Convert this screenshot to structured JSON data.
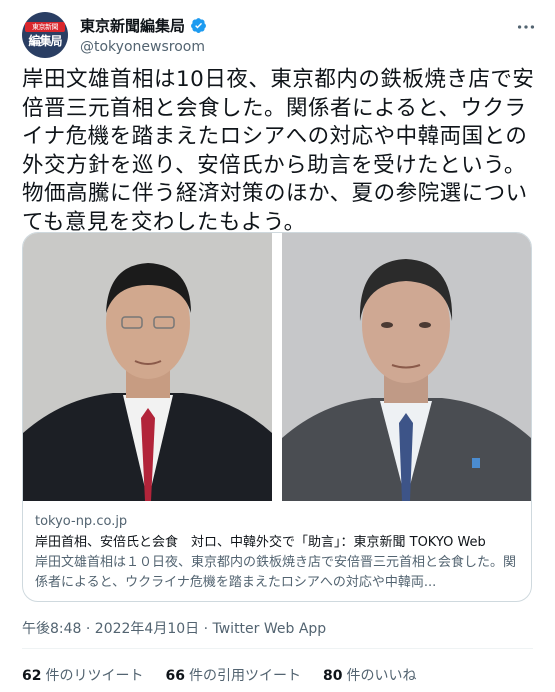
{
  "account": {
    "display_name": "東京新聞編集局",
    "handle": "@tokyonewsroom",
    "avatar_text_top": "東京新聞",
    "avatar_text_bottom": "編集局"
  },
  "tweet": {
    "text": "岸田文雄首相は10日夜、東京都内の鉄板焼き店で安倍晋三元首相と会食した。関係者によると、ウクライナ危機を踏まえたロシアへの対応や中韓両国との外交方針を巡り、安倍氏から助言を受けたという。物価高騰に伴う経済対策のほか、夏の参院選についても意見を交わしたもよう。"
  },
  "card": {
    "domain": "tokyo-np.co.jp",
    "title": "岸田首相、安倍氏と会食　対ロ、中韓外交で「助言」：東京新聞 TOKYO Web",
    "description": "岸田文雄首相は１０日夜、東京都内の鉄板焼き店で安倍晋三元首相と会食した。関係者によると、ウクライナ危機を踏まえたロシアへの対応や中韓両..."
  },
  "meta": {
    "timestamp": "午後8:48 · 2022年4月10日 · Twitter Web App"
  },
  "stats": {
    "retweets_count": "62",
    "retweets_label": "件のリツイート",
    "quotes_count": "66",
    "quotes_label": "件の引用ツイート",
    "likes_count": "80",
    "likes_label": "件のいいね"
  },
  "colors": {
    "verified": "#1d9bf0",
    "secondary_text": "#536471",
    "border": "#cfd9de"
  },
  "icons": [
    "verified-badge-icon",
    "more-options-icon"
  ]
}
